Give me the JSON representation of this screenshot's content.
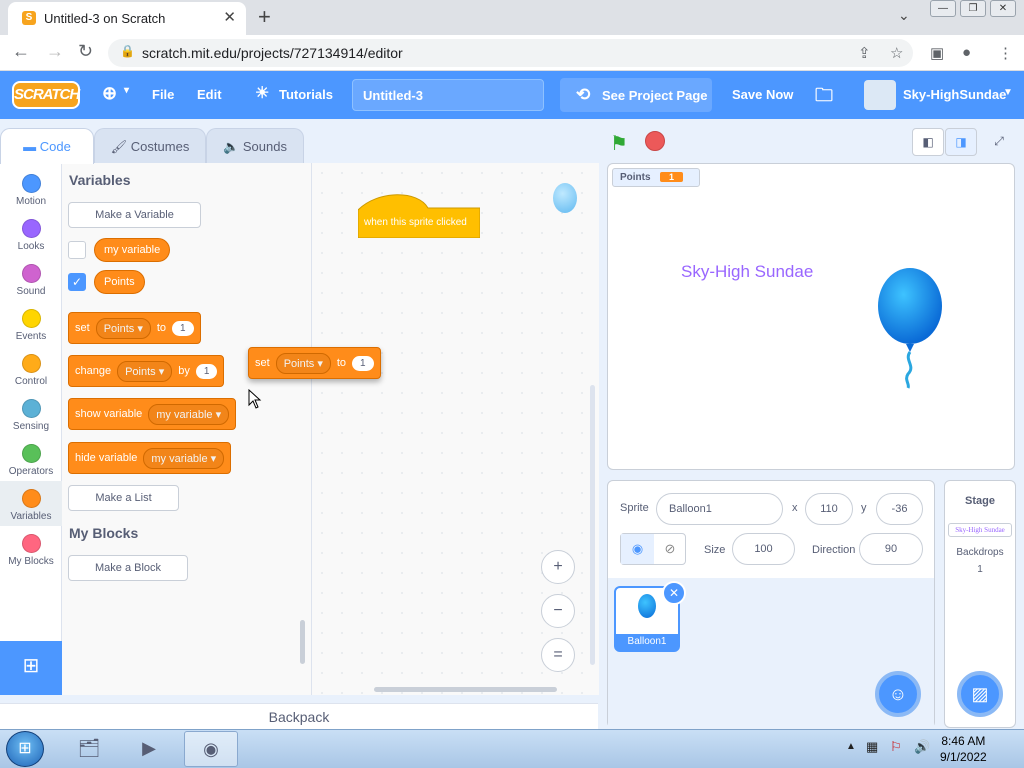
{
  "browser": {
    "tab_title": "Untitled-3 on Scratch",
    "url": "scratch.mit.edu/projects/727134914/editor",
    "tab_favicon": "S"
  },
  "menu": {
    "logo": "SCRATCH",
    "file": "File",
    "edit": "Edit",
    "tutorials": "Tutorials",
    "project_title": "Untitled-3",
    "see_project": "See Project Page",
    "save_now": "Save Now",
    "username": "Sky-HighSundae"
  },
  "tabs": {
    "code": "Code",
    "costumes": "Costumes",
    "sounds": "Sounds"
  },
  "categories": [
    {
      "label": "Motion",
      "color": "#4c97ff"
    },
    {
      "label": "Looks",
      "color": "#9966ff"
    },
    {
      "label": "Sound",
      "color": "#cf63cf"
    },
    {
      "label": "Events",
      "color": "#ffd500"
    },
    {
      "label": "Control",
      "color": "#ffab19"
    },
    {
      "label": "Sensing",
      "color": "#5cb1d6"
    },
    {
      "label": "Operators",
      "color": "#59c059"
    },
    {
      "label": "Variables",
      "color": "#ff8c1a"
    },
    {
      "label": "My Blocks",
      "color": "#ff6680"
    }
  ],
  "palette": {
    "variables_heading": "Variables",
    "make_variable": "Make a Variable",
    "var1": "my variable",
    "var2": "Points",
    "set": {
      "word": "set",
      "var": "Points",
      "to": "to",
      "value": "1"
    },
    "change": {
      "word": "change",
      "var": "Points",
      "by": "by",
      "value": "1"
    },
    "show": {
      "word": "show variable",
      "var": "my variable"
    },
    "hide": {
      "word": "hide variable",
      "var": "my variable"
    },
    "make_list": "Make a List",
    "myblocks_heading": "My Blocks",
    "make_block": "Make a Block"
  },
  "script": {
    "hat": "when this sprite clicked",
    "drag": {
      "word": "set",
      "var": "Points",
      "to": "to",
      "value": "1"
    }
  },
  "zoom": {
    "in": "+",
    "out": "−",
    "reset": "="
  },
  "backpack": "Backpack",
  "stage": {
    "monitor_label": "Points",
    "monitor_value": "1",
    "text": "Sky-High Sundae"
  },
  "sprite": {
    "label": "Sprite",
    "name": "Balloon1",
    "x_label": "x",
    "x": "110",
    "y_label": "y",
    "y": "-36",
    "show_label": "Show",
    "size_label": "Size",
    "size": "100",
    "direction_label": "Direction",
    "direction": "90",
    "thumb_name": "Balloon1"
  },
  "stage_pane": {
    "title": "Stage",
    "thumb_text": "Sky-High Sundae",
    "backdrops_label": "Backdrops",
    "backdrops_count": "1"
  },
  "taskbar": {
    "time": "8:46 AM",
    "date": "9/1/2022"
  }
}
